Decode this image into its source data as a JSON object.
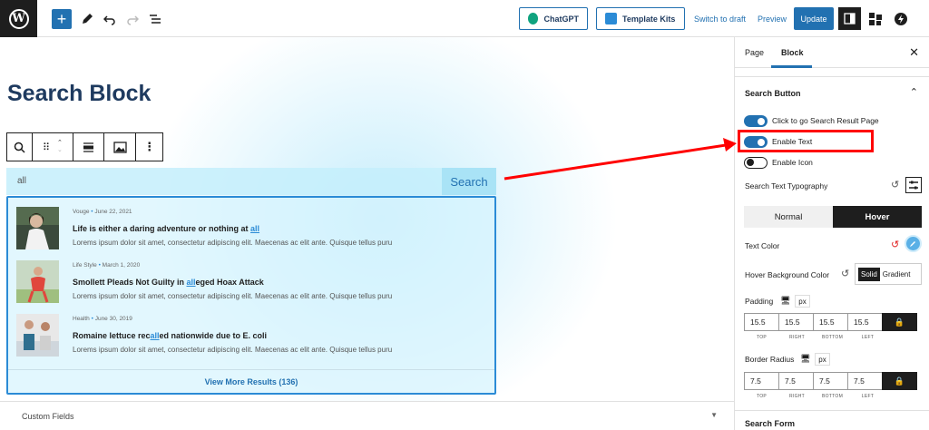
{
  "topbar": {
    "chatgpt_label": "ChatGPT",
    "template_kits_label": "Template Kits",
    "switch_draft_label": "Switch to draft",
    "preview_label": "Preview",
    "update_label": "Update",
    "accent_color": "#2271b1"
  },
  "canvas": {
    "page_title": "Search Block",
    "search": {
      "query": "all",
      "button_label": "Search"
    },
    "results": [
      {
        "category": "Vouge",
        "date": "June 22, 2021",
        "title_parts": [
          "Life is either a daring adventure or nothing at ",
          "all",
          ""
        ],
        "excerpt": "Lorems ipsum dolor sit amet, consectetur adipiscing elit. Maecenas ac elit ante. Quisque tellus puru"
      },
      {
        "category": "Life Style",
        "date": "March 1, 2020",
        "title_parts": [
          "Smollett Pleads Not Guilty in ",
          "all",
          "eged Hoax Attack"
        ],
        "excerpt": "Lorems ipsum dolor sit amet, consectetur adipiscing elit. Maecenas ac elit ante. Quisque tellus puru"
      },
      {
        "category": "Health",
        "date": "June 30, 2019",
        "title_parts": [
          "Romaine lettuce rec",
          "all",
          "ed nationwide due to E. coli"
        ],
        "excerpt": "Lorems ipsum dolor sit amet, consectetur adipiscing elit. Maecenas ac elit ante. Quisque tellus puru"
      }
    ],
    "view_more_label": "View More Results (136)",
    "custom_fields_label": "Custom Fields"
  },
  "sidebar": {
    "tabs": [
      "Page",
      "Block"
    ],
    "search_button_heading": "Search Button",
    "toggles": [
      {
        "label": "Click to go Search Result Page",
        "on": true
      },
      {
        "label": "Enable Text",
        "on": true
      },
      {
        "label": "Enable Icon",
        "on": false
      }
    ],
    "typography_label": "Search Text Typography",
    "state_tabs": [
      "Normal",
      "Hover"
    ],
    "text_color_label": "Text Color",
    "hover_bg_label": "Hover Background Color",
    "solid_label": "Solid",
    "gradient_label": "Gradient",
    "padding_label": "Padding",
    "unit": "px",
    "padding_values": [
      "15.5",
      "15.5",
      "15.5",
      "15.5"
    ],
    "border_radius_label": "Border Radius",
    "radius_values": [
      "7.5",
      "7.5",
      "7.5",
      "7.5"
    ],
    "dim_labels": [
      "TOP",
      "RIGHT",
      "BOTTOM",
      "LEFT"
    ],
    "search_form_heading": "Search Form"
  }
}
